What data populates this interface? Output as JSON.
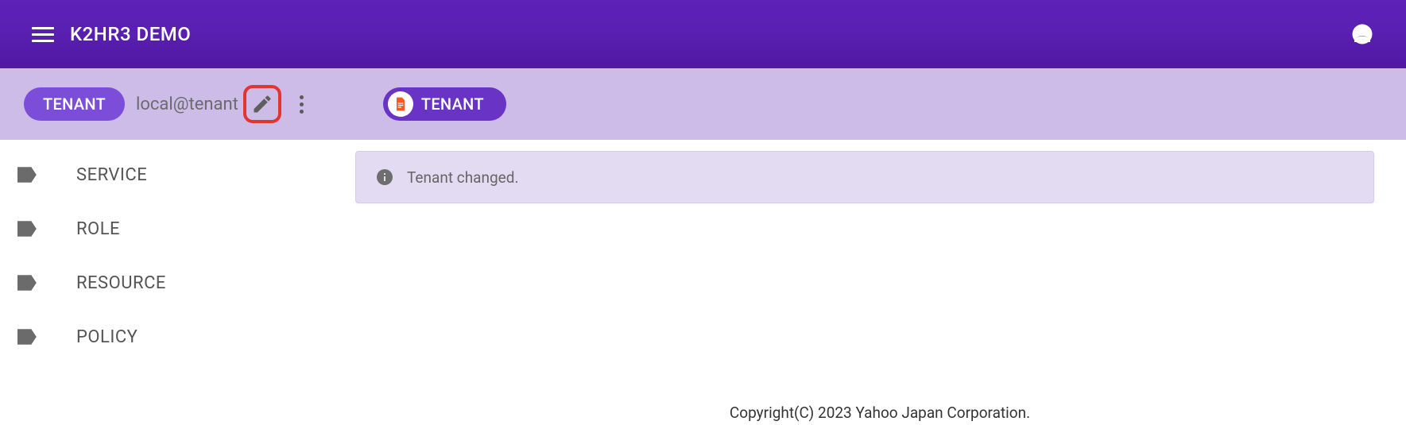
{
  "appbar": {
    "title": "K2HR3 DEMO"
  },
  "subbar": {
    "tenant_chip_label": "TENANT",
    "tenant_name": "local@tenant",
    "path_chip_label": "TENANT"
  },
  "sidebar": {
    "items": [
      {
        "label": "SERVICE"
      },
      {
        "label": "ROLE"
      },
      {
        "label": "RESOURCE"
      },
      {
        "label": "POLICY"
      }
    ]
  },
  "content": {
    "banner_text": "Tenant changed."
  },
  "footer": {
    "text": "Copyright(C) 2023 Yahoo Japan Corporation."
  }
}
